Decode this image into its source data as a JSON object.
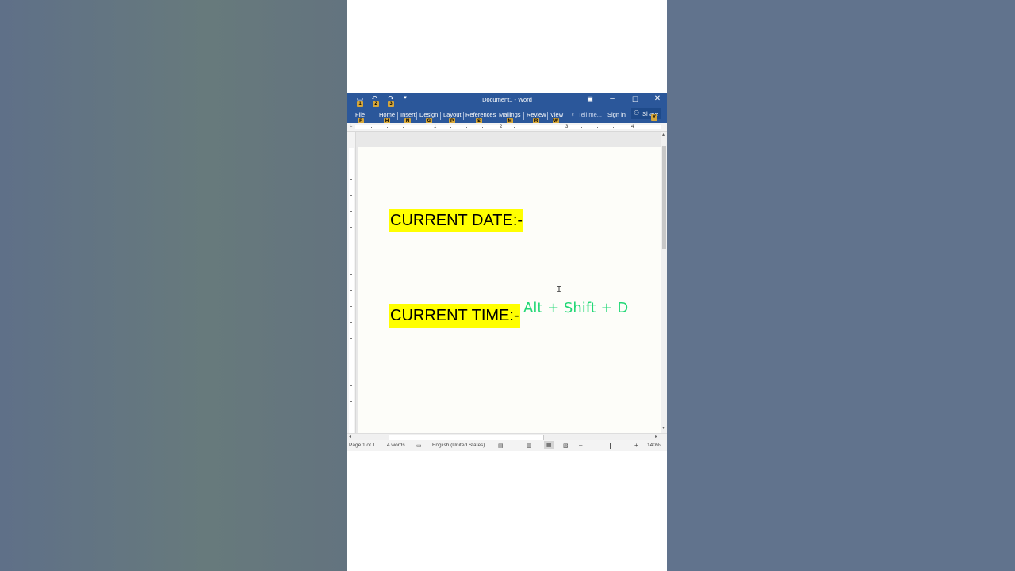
{
  "window": {
    "title": "Document1 - Word",
    "keytips_qat": [
      "1",
      "2",
      "3"
    ]
  },
  "tabs": [
    {
      "label": "File",
      "keytip": "F"
    },
    {
      "label": "Home",
      "keytip": "H"
    },
    {
      "label": "Insert",
      "keytip": "N"
    },
    {
      "label": "Design",
      "keytip": "G"
    },
    {
      "label": "Layout",
      "keytip": "P"
    },
    {
      "label": "References",
      "keytip": "S"
    },
    {
      "label": "Mailings",
      "keytip": "M"
    },
    {
      "label": "Review",
      "keytip": "R"
    },
    {
      "label": "View",
      "keytip": "W"
    }
  ],
  "tell_me": {
    "label": "Tell me..."
  },
  "sign_in": {
    "label": "Sign in"
  },
  "share": {
    "label": "Share",
    "keytip": "Y"
  },
  "ruler_numbers": [
    "1",
    "2",
    "3",
    "4"
  ],
  "document": {
    "line1": "CURRENT DATE:-",
    "line2": "CURRENT TIME:-",
    "shortcut_hint": "Alt + Shift + D",
    "cursor_glyph": "I"
  },
  "status": {
    "page": "Page 1 of 1",
    "words": "4 words",
    "language": "English (United States)",
    "zoom": "140%"
  },
  "colors": {
    "ribbon": "#2b579a",
    "highlight": "#ffff00",
    "shortcut_text": "#22d876"
  }
}
